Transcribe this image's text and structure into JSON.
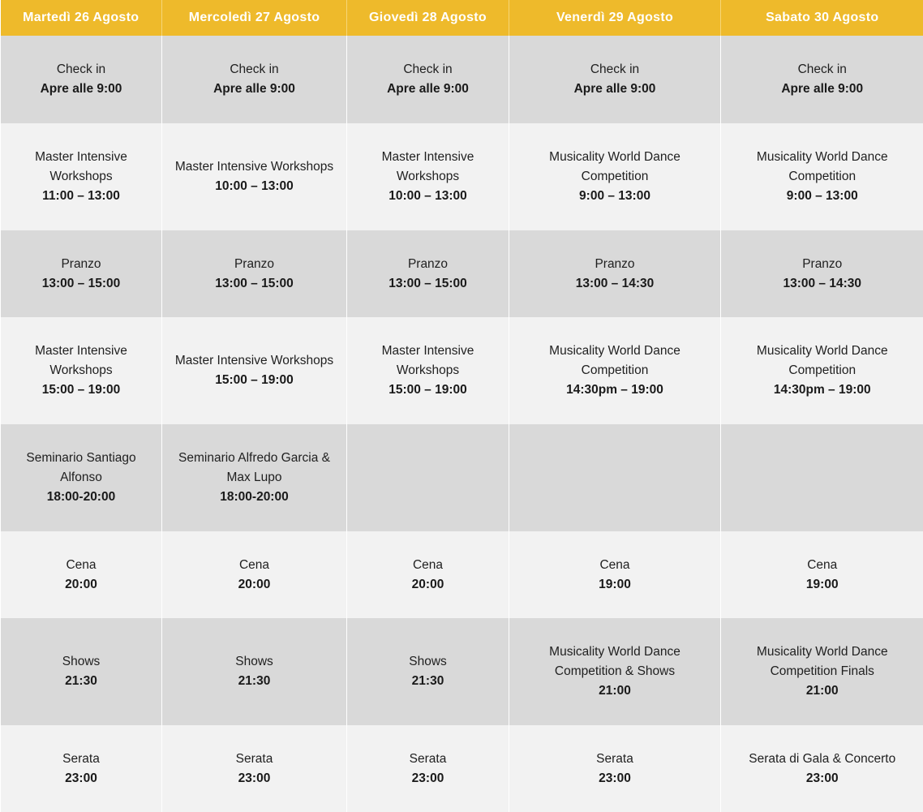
{
  "days": [
    "Martedì 26 Agosto",
    "Mercoledì 27 Agosto",
    "Giovedì 28 Agosto",
    "Venerdì 29 Agosto",
    "Sabato 30 Agosto"
  ],
  "rows": [
    {
      "cells": [
        {
          "title": "Check in",
          "time": "Apre alle 9:00"
        },
        {
          "title": "Check in",
          "time": "Apre alle 9:00"
        },
        {
          "title": "Check in",
          "time": "Apre alle 9:00"
        },
        {
          "title": "Check in",
          "time": "Apre alle 9:00"
        },
        {
          "title": "Check in",
          "time": "Apre alle 9:00"
        }
      ]
    },
    {
      "cells": [
        {
          "title": "Master Intensive Workshops",
          "time": "11:00 – 13:00"
        },
        {
          "title": "Master Intensive Workshops",
          "time": "10:00 – 13:00"
        },
        {
          "title": "Master Intensive Workshops",
          "time": "10:00 – 13:00"
        },
        {
          "title": "Musicality World Dance Competition",
          "time": "9:00 – 13:00"
        },
        {
          "title": "Musicality World Dance Competition",
          "time": "9:00 – 13:00"
        }
      ]
    },
    {
      "cells": [
        {
          "title": "Pranzo",
          "time": "13:00 – 15:00"
        },
        {
          "title": "Pranzo",
          "time": "13:00 – 15:00"
        },
        {
          "title": "Pranzo",
          "time": "13:00 – 15:00"
        },
        {
          "title": "Pranzo",
          "time": "13:00 – 14:30"
        },
        {
          "title": "Pranzo",
          "time": "13:00 – 14:30"
        }
      ]
    },
    {
      "cells": [
        {
          "title": "Master Intensive Workshops",
          "time": "15:00 – 19:00"
        },
        {
          "title": "Master Intensive Workshops",
          "time": "15:00 – 19:00"
        },
        {
          "title": "Master Intensive Workshops",
          "time": "15:00 – 19:00"
        },
        {
          "title": "Musicality World Dance Competition",
          "time": "14:30pm – 19:00"
        },
        {
          "title": "Musicality World Dance Competition",
          "time": "14:30pm – 19:00"
        }
      ]
    },
    {
      "cells": [
        {
          "title": "Seminario Santiago Alfonso",
          "time": "18:00-20:00"
        },
        {
          "title": "Seminario Alfredo Garcia & Max Lupo",
          "time": "18:00-20:00"
        },
        {
          "title": "",
          "time": ""
        },
        {
          "title": "",
          "time": ""
        },
        {
          "title": "",
          "time": ""
        }
      ]
    },
    {
      "cells": [
        {
          "title": "Cena",
          "time": "20:00"
        },
        {
          "title": "Cena",
          "time": "20:00"
        },
        {
          "title": "Cena",
          "time": "20:00"
        },
        {
          "title": "Cena",
          "time": "19:00"
        },
        {
          "title": "Cena",
          "time": "19:00"
        }
      ]
    },
    {
      "cells": [
        {
          "title": "Shows",
          "time": "21:30"
        },
        {
          "title": "Shows",
          "time": "21:30"
        },
        {
          "title": "Shows",
          "time": "21:30"
        },
        {
          "title": "Musicality World Dance Competition & Shows",
          "time": "21:00"
        },
        {
          "title": "Musicality World Dance Competition Finals",
          "time": "21:00"
        }
      ]
    },
    {
      "cells": [
        {
          "title": "Serata",
          "time": "23:00"
        },
        {
          "title": "Serata",
          "time": "23:00"
        },
        {
          "title": "Serata",
          "time": "23:00"
        },
        {
          "title": "Serata",
          "time": "23:00"
        },
        {
          "title": "Serata di Gala & Concerto",
          "time": "23:00"
        }
      ]
    }
  ],
  "colors": {
    "header_bg": "#eeba2b",
    "header_text": "#ffffff",
    "row_dark": "#d9d9d9",
    "row_light": "#f2f2f2"
  }
}
